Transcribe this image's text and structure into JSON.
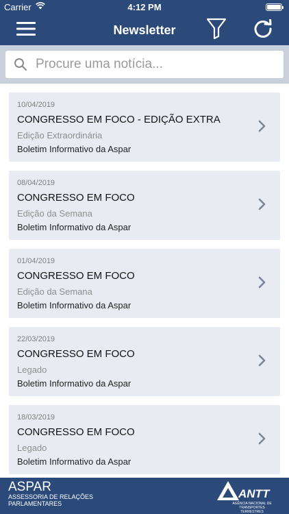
{
  "status": {
    "carrier": "Carrier",
    "time": "4:12 PM"
  },
  "header": {
    "title": "Newsletter"
  },
  "search": {
    "placeholder": "Procure uma notícia..."
  },
  "items": [
    {
      "date": "10/04/2019",
      "title": "CONGRESSO EM FOCO - EDIÇÃO EXTRA",
      "subtitle": "Edição Extraordinária",
      "source": "Boletim Informativo da Aspar"
    },
    {
      "date": "08/04/2019",
      "title": "CONGRESSO EM FOCO",
      "subtitle": "Edição da Semana",
      "source": "Boletim Informativo da Aspar"
    },
    {
      "date": "01/04/2019",
      "title": "CONGRESSO EM FOCO",
      "subtitle": "Edição da Semana",
      "source": "Boletim Informativo da Aspar"
    },
    {
      "date": "22/03/2019",
      "title": "CONGRESSO EM FOCO",
      "subtitle": "Legado",
      "source": "Boletim Informativo da Aspar"
    },
    {
      "date": "18/03/2019",
      "title": "CONGRESSO EM FOCO",
      "subtitle": "Legado",
      "source": "Boletim Informativo da Aspar"
    }
  ],
  "footer": {
    "org_name": "ASPAR",
    "org_subtitle": "ASSESSORIA DE RELAÇÕES PARLAMENTARES",
    "logo_name": "ANTT",
    "logo_subtitle": "AGÊNCIA NACIONAL DE TRANSPORTES TERRESTRES"
  },
  "colors": {
    "primary": "#2b4a7a",
    "card_bg": "#e8ecf2",
    "search_bg": "#c9d0db"
  },
  "icons": {
    "menu": "hamburger-icon",
    "filter": "filter-icon",
    "refresh": "refresh-icon",
    "search": "search-icon",
    "chevron": "chevron-right-icon",
    "wifi": "wifi-icon",
    "battery": "battery-icon"
  }
}
